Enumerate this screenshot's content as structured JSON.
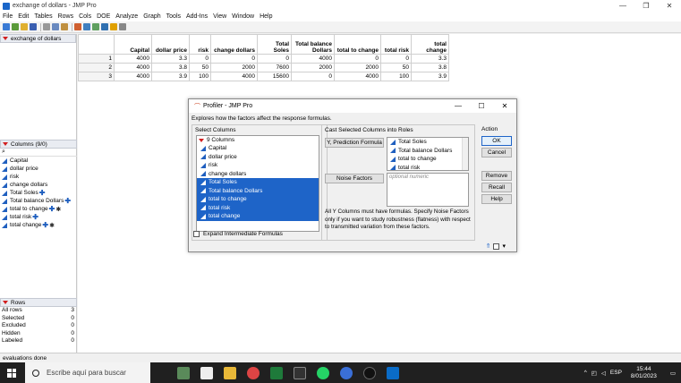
{
  "window": {
    "title": "exchange of dollars - JMP Pro",
    "controls": [
      "—",
      "❐",
      "✕"
    ]
  },
  "menu": [
    "File",
    "Edit",
    "Tables",
    "Rows",
    "Cols",
    "DOE",
    "Analyze",
    "Graph",
    "Tools",
    "Add-Ins",
    "View",
    "Window",
    "Help"
  ],
  "table_panel": {
    "title": "exchange of dollars"
  },
  "columns_panel": {
    "title": "Columns (9/0)",
    "items": [
      {
        "name": "Capital",
        "plus": false,
        "star": false
      },
      {
        "name": "dollar price",
        "plus": false,
        "star": false
      },
      {
        "name": "risk",
        "plus": false,
        "star": false
      },
      {
        "name": "change dollars",
        "plus": false,
        "star": false
      },
      {
        "name": "Total Soles",
        "plus": true,
        "star": false
      },
      {
        "name": "Total balance Dollars",
        "plus": true,
        "star": false
      },
      {
        "name": "total to change",
        "plus": true,
        "star": true
      },
      {
        "name": "total risk",
        "plus": true,
        "star": false
      },
      {
        "name": "total change",
        "plus": true,
        "star": true
      }
    ]
  },
  "rows_panel": {
    "title": "Rows",
    "stats": [
      {
        "label": "All rows",
        "value": "3"
      },
      {
        "label": "Selected",
        "value": "0"
      },
      {
        "label": "Excluded",
        "value": "0"
      },
      {
        "label": "Hidden",
        "value": "0"
      },
      {
        "label": "Labeled",
        "value": "0"
      }
    ]
  },
  "table": {
    "headers": [
      "Capital",
      "dollar price",
      "risk",
      "change dollars",
      "Total Soles",
      "Total balance Dollars",
      "total to change",
      "total risk",
      "total change"
    ],
    "rows": [
      {
        "n": "1",
        "cells": [
          "4000",
          "3.3",
          "0",
          "0",
          "0",
          "4000",
          "0",
          "0",
          "3.3"
        ]
      },
      {
        "n": "2",
        "cells": [
          "4000",
          "3.8",
          "50",
          "2000",
          "7600",
          "2000",
          "2000",
          "50",
          "3.8"
        ]
      },
      {
        "n": "3",
        "cells": [
          "4000",
          "3.9",
          "100",
          "4000",
          "15600",
          "0",
          "4000",
          "100",
          "3.9"
        ]
      }
    ]
  },
  "status": {
    "text": "evaluations done"
  },
  "taskbar": {
    "search_placeholder": "Escribe aquí para buscar",
    "lang": "ESP",
    "time": "15:44",
    "date": "8/01/2023"
  },
  "dialog": {
    "title": "Profiler - JMP Pro",
    "description": "Explores how the factors affect the response formulas.",
    "select_label": "Select Columns",
    "columns_count": "9 Columns",
    "columns": [
      {
        "name": "Capital",
        "selected": false
      },
      {
        "name": "dollar price",
        "selected": false
      },
      {
        "name": "risk",
        "selected": false
      },
      {
        "name": "change dollars",
        "selected": false
      },
      {
        "name": "Total Soles",
        "selected": true
      },
      {
        "name": "Total balance Dollars",
        "selected": true
      },
      {
        "name": "total to change",
        "selected": true
      },
      {
        "name": "total risk",
        "selected": true
      },
      {
        "name": "total change",
        "selected": true
      }
    ],
    "expand_label": "Expand Intermediate Formulas",
    "cast_label": "Cast Selected Columns into Roles",
    "y_button": "Y, Prediction Formula",
    "y_roles": [
      "Total Soles",
      "Total balance Dollars",
      "total to change",
      "total risk"
    ],
    "noise_button": "Noise Factors",
    "noise_placeholder": "optional numeric",
    "note": "All Y Columns must have formulas.  Specify Noise Factors only if you want to study robustness (flatness) with respect to transmitted variation from these factors.",
    "action_label": "Action",
    "buttons": {
      "ok": "OK",
      "cancel": "Cancel",
      "remove": "Remove",
      "recall": "Recall",
      "help": "Help"
    }
  }
}
